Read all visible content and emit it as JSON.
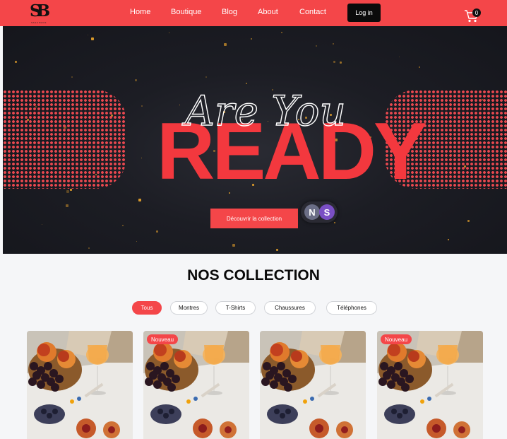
{
  "nav": {
    "logo_text": "SB",
    "logo_tagline": "SAGA BAGS",
    "links": [
      "Home",
      "Boutique",
      "Blog",
      "About",
      "Contact"
    ],
    "login_label": "Log in",
    "cart_icon": "cart-icon",
    "cart_count": "0"
  },
  "hero": {
    "script_text": "Are You",
    "headline": "READY",
    "cta_label": "Découvrir la collection",
    "avatars": [
      "N",
      "S"
    ]
  },
  "collection": {
    "title": "NOS COLLECTION",
    "filters": [
      "Tous",
      "Montres",
      "T-Shirts",
      "Chaussures",
      "Téléphones"
    ],
    "active_filter": "Tous",
    "cards": [
      {
        "badge": ""
      },
      {
        "badge": "Nouveau"
      },
      {
        "badge": ""
      },
      {
        "badge": "Nouveau"
      }
    ]
  },
  "colors": {
    "accent": "#f44649",
    "headline": "#f3383e",
    "dark": "#0b0b0b"
  }
}
